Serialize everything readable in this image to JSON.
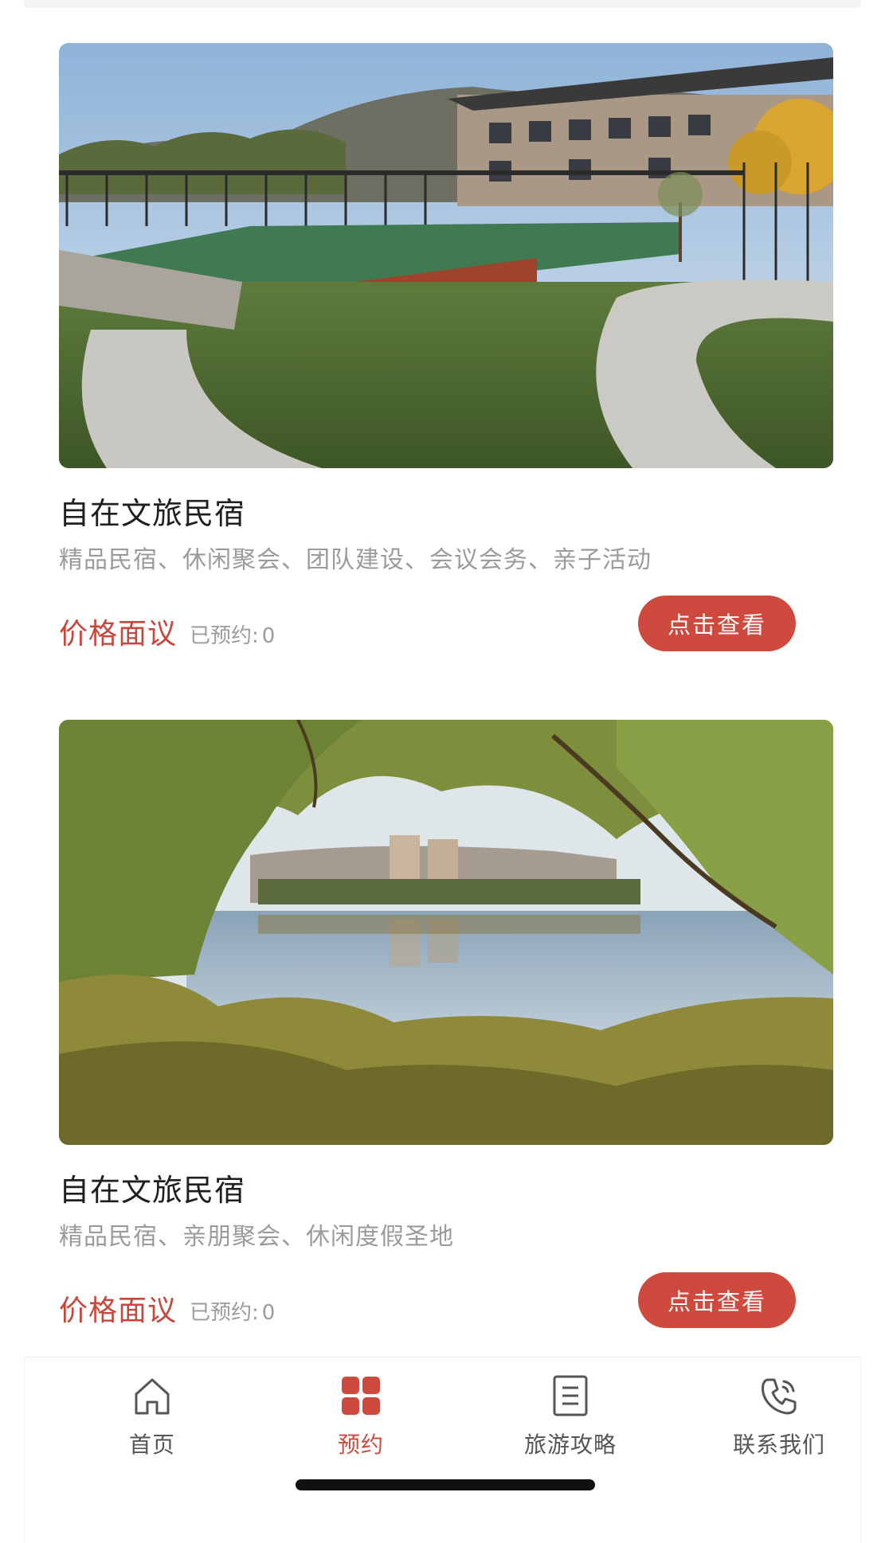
{
  "listings": [
    {
      "title": "自在文旅民宿",
      "tags": "精品民宿、休闲聚会、团队建设、会议会务、亲子活动",
      "price": "价格面议",
      "booked_label": "已预约:",
      "booked_count": "0",
      "button": "点击查看"
    },
    {
      "title": "自在文旅民宿",
      "tags": "精品民宿、亲朋聚会、休闲度假圣地",
      "price": "价格面议",
      "booked_label": "已预约:",
      "booked_count": "0",
      "button": "点击查看"
    }
  ],
  "tabbar": {
    "items": [
      {
        "label": "首页",
        "icon": "home-icon",
        "active": false
      },
      {
        "label": "预约",
        "icon": "grid-icon",
        "active": true
      },
      {
        "label": "旅游攻略",
        "icon": "document-icon",
        "active": false
      },
      {
        "label": "联系我们",
        "icon": "phone-icon",
        "active": false
      }
    ]
  },
  "colors": {
    "accent": "#cf4a3e",
    "price": "#c8473c",
    "muted_text": "#9b9b9b",
    "title_text": "#1f1f1f"
  }
}
